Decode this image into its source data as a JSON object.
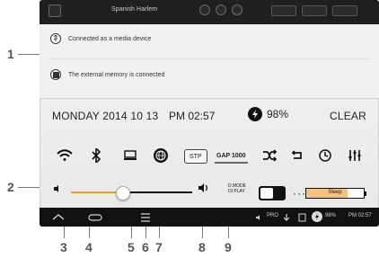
{
  "callouts": {
    "n1": "1",
    "n2": "2",
    "n3": "3",
    "n4": "4",
    "n5": "5",
    "n6": "6",
    "n7": "7",
    "n8": "8",
    "n9": "9"
  },
  "topbar": {
    "title": "Spanish Harlem"
  },
  "notifications": [
    {
      "text": "Connected as a media device",
      "icon": "usb-icon"
    },
    {
      "text": "The external memory is connected",
      "icon": "memory-icon"
    }
  ],
  "status": {
    "day_date": "MONDAY 2014 10 13",
    "time": "PM 02:57",
    "battery_percent": "98%",
    "clear_label": "CLEAR"
  },
  "quick_settings": {
    "icons": [
      "wifi-icon",
      "bluetooth-icon",
      "dock-icon",
      "globe-icon",
      "rotate-icon",
      "gap-icon",
      "shuffle-icon",
      "repeat-icon",
      "sync-icon",
      "equalizer-icon"
    ],
    "stop_label": "STP",
    "gap_label": "GAP 1000"
  },
  "slider": {
    "value_fraction": 0.43,
    "mode_label_top": "D.MODE",
    "mode_label_bottom": "DI PLAY",
    "sleep_label": "Sleep",
    "sleep_fill": 0.72
  },
  "navbar": {
    "pro_label": "PRO",
    "battery_percent": "98%",
    "time": "PM 02:57"
  }
}
